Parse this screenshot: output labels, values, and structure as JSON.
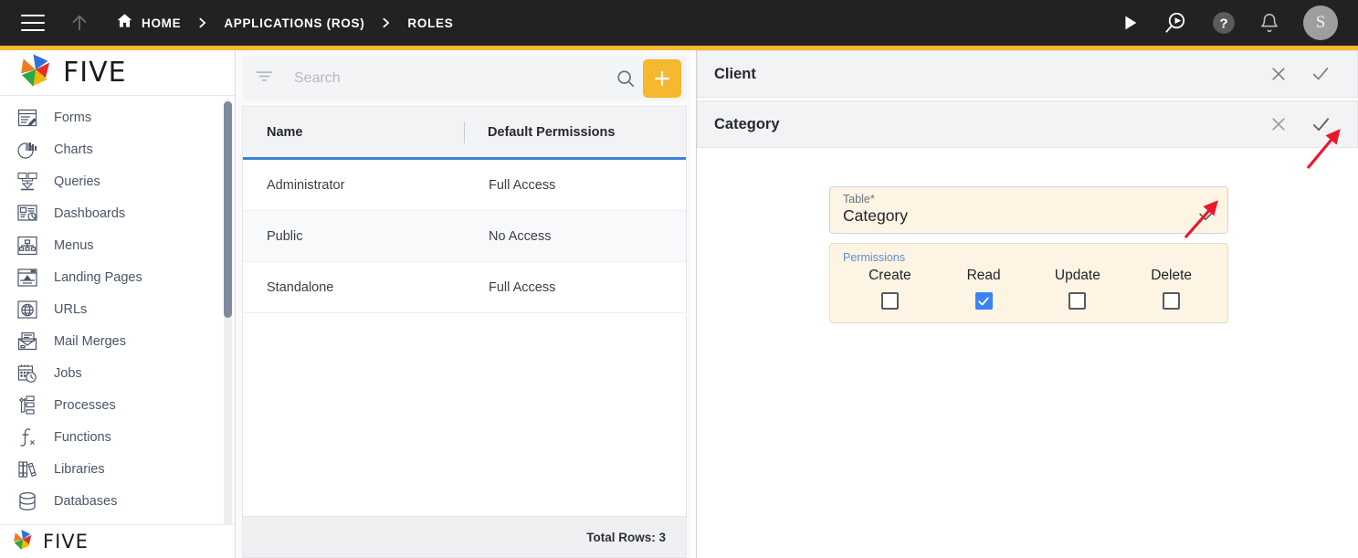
{
  "topbar": {
    "menu_icon": "hamburger-menu-icon",
    "up_icon": "arrow-up-icon",
    "breadcrumb": [
      {
        "label": "HOME",
        "icon": "home-icon"
      },
      {
        "label": "APPLICATIONS (ROS)",
        "icon": ""
      },
      {
        "label": "ROLES",
        "icon": ""
      }
    ],
    "actions": [
      {
        "name": "run-icon",
        "glyph": "▶"
      },
      {
        "name": "debug-search-icon",
        "glyph": ""
      },
      {
        "name": "help-icon",
        "glyph": "?"
      },
      {
        "name": "notifications-bell-icon",
        "glyph": ""
      }
    ],
    "avatar_initial": "S",
    "accent_color": "#F5B82E",
    "bar_color": "#222222"
  },
  "sidebar": {
    "logo_text": "FIVE",
    "footer_logo_text": "FIVE",
    "items": [
      {
        "label": "Forms",
        "icon": "forms-icon"
      },
      {
        "label": "Charts",
        "icon": "charts-icon"
      },
      {
        "label": "Queries",
        "icon": "queries-icon"
      },
      {
        "label": "Dashboards",
        "icon": "dashboards-icon"
      },
      {
        "label": "Menus",
        "icon": "menus-icon"
      },
      {
        "label": "Landing Pages",
        "icon": "landing-pages-icon"
      },
      {
        "label": "URLs",
        "icon": "urls-icon"
      },
      {
        "label": "Mail Merges",
        "icon": "mail-merges-icon"
      },
      {
        "label": "Jobs",
        "icon": "jobs-icon"
      },
      {
        "label": "Processes",
        "icon": "processes-icon"
      },
      {
        "label": "Functions",
        "icon": "functions-icon"
      },
      {
        "label": "Libraries",
        "icon": "libraries-icon"
      },
      {
        "label": "Databases",
        "icon": "databases-icon"
      }
    ]
  },
  "list_panel": {
    "search_placeholder": "Search",
    "search_value": "",
    "filter_icon": "filter-icon",
    "search_icon": "search-icon",
    "add_label": "+",
    "columns": [
      "Name",
      "Default Permissions"
    ],
    "rows": [
      {
        "name": "Administrator",
        "permissions": "Full Access"
      },
      {
        "name": "Public",
        "permissions": "No Access"
      },
      {
        "name": "Standalone",
        "permissions": "Full Access"
      }
    ],
    "footer": "Total Rows: 3"
  },
  "detail": {
    "cards": [
      {
        "title": "Client",
        "close_icon": "close-icon",
        "confirm_icon": "check-icon"
      },
      {
        "title": "Category",
        "close_icon": "close-icon",
        "confirm_icon": "check-icon"
      }
    ],
    "table_field": {
      "label": "Table",
      "required_marker": "*",
      "value": "Category",
      "chevron_icon": "chevron-down-icon"
    },
    "permissions": {
      "legend": "Permissions",
      "accent_color": "#3b82f6",
      "options": [
        {
          "label": "Create",
          "checked": false
        },
        {
          "label": "Read",
          "checked": true
        },
        {
          "label": "Update",
          "checked": false
        },
        {
          "label": "Delete",
          "checked": false
        }
      ]
    }
  },
  "annotations": [
    {
      "name": "arrow-to-confirm-check",
      "color": "#e8192c"
    },
    {
      "name": "arrow-to-table-chevron",
      "color": "#e8192c"
    }
  ]
}
